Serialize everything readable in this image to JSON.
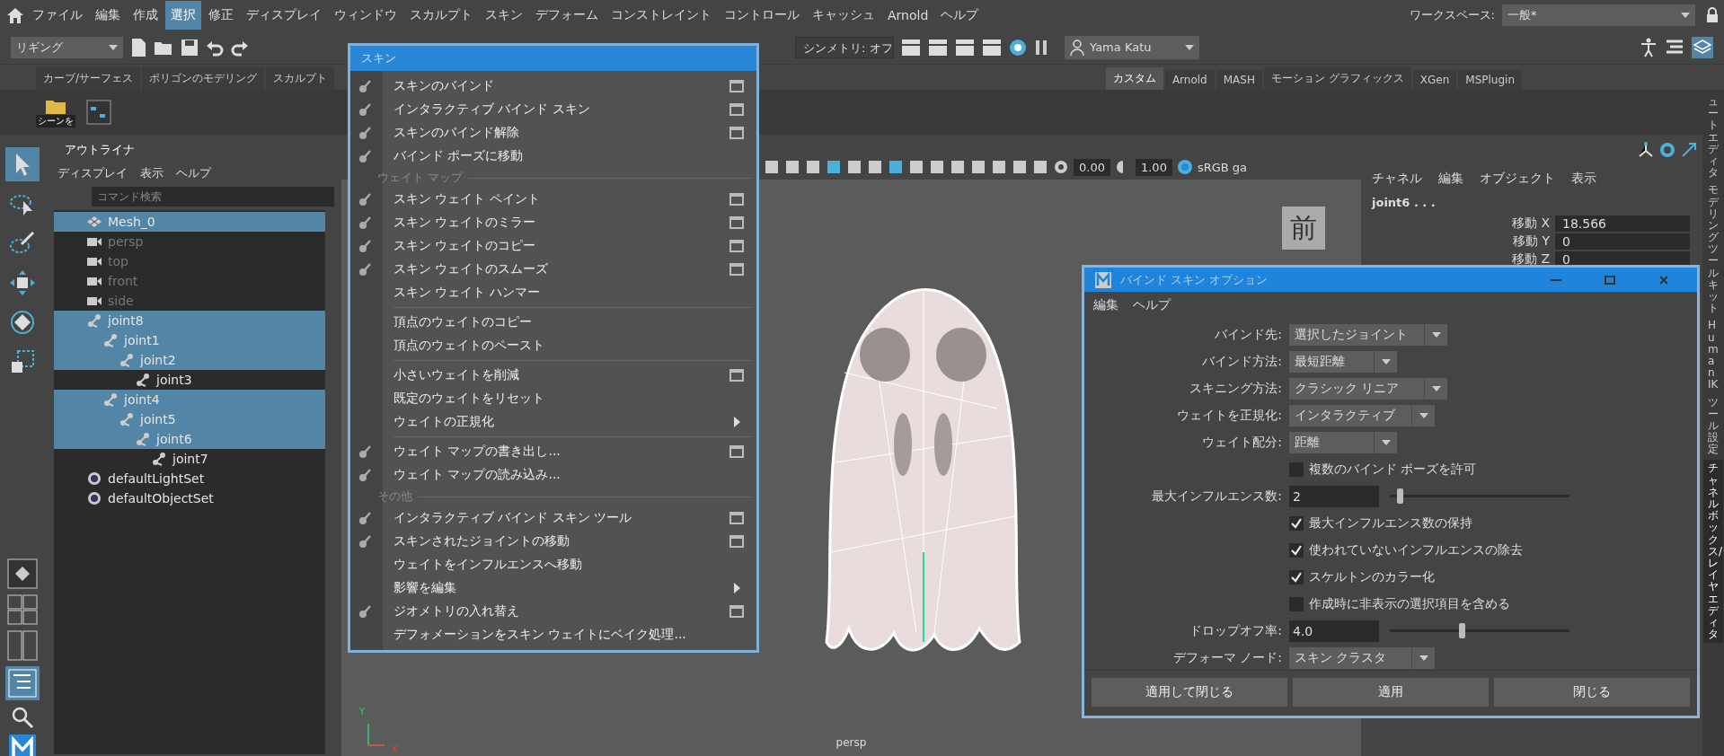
{
  "menu_bar": {
    "items": [
      {
        "label": "ファイル",
        "selected": false
      },
      {
        "label": "編集",
        "selected": false
      },
      {
        "label": "作成",
        "selected": false
      },
      {
        "label": "選択",
        "selected": true
      },
      {
        "label": "修正",
        "selected": false
      },
      {
        "label": "ディスプレイ",
        "selected": false
      },
      {
        "label": "ウィンドウ",
        "selected": false
      },
      {
        "label": "スカルプト",
        "selected": false
      },
      {
        "label": "スキン",
        "selected": false
      },
      {
        "label": "デフォーム",
        "selected": false
      },
      {
        "label": "コンストレイント",
        "selected": false
      },
      {
        "label": "コントロール",
        "selected": false
      },
      {
        "label": "キャッシュ",
        "selected": false
      },
      {
        "label": "Arnold",
        "selected": false
      },
      {
        "label": "ヘルプ",
        "selected": false
      }
    ],
    "workspace_label": "ワークスペース:",
    "workspace_value": "一般*"
  },
  "status_line": {
    "mode": "リギング",
    "symmetry": "シンメトリ: オフ",
    "user": "Yama Katu"
  },
  "shelf": {
    "tabs": [
      {
        "label": "カーブ/サーフェス",
        "selected": false
      },
      {
        "label": "ポリゴンのモデリング",
        "selected": false
      },
      {
        "label": "スカルプト",
        "selected": false
      },
      {
        "label": "カスタム",
        "selected": true
      },
      {
        "label": "Arnold",
        "selected": false
      },
      {
        "label": "MASH",
        "selected": false
      },
      {
        "label": "モーション グラフィックス",
        "selected": false
      },
      {
        "label": "XGen",
        "selected": false
      },
      {
        "label": "MSPlugin",
        "selected": false
      }
    ],
    "items": [
      {
        "label": "シーンを"
      }
    ]
  },
  "toolbox": {
    "tools": [
      {
        "kind": "select",
        "selected": true
      },
      {
        "kind": "lasso",
        "selected": false
      },
      {
        "kind": "paint",
        "selected": false
      },
      {
        "kind": "move",
        "selected": false
      },
      {
        "kind": "rotate",
        "selected": false
      },
      {
        "kind": "scale",
        "selected": false
      }
    ]
  },
  "outliner": {
    "tab": "アウトライナ",
    "menus": [
      "ディスプレイ",
      "表示",
      "ヘルプ"
    ],
    "placeholder": "コマンド検索",
    "items": [
      {
        "label": "Mesh_0",
        "kind": "mesh",
        "selected": true,
        "dimmed": false
      },
      {
        "label": "persp",
        "kind": "camera",
        "selected": false,
        "dimmed": true
      },
      {
        "label": "top",
        "kind": "camera",
        "selected": false,
        "dimmed": true
      },
      {
        "label": "front",
        "kind": "camera",
        "selected": false,
        "dimmed": true
      },
      {
        "label": "side",
        "kind": "camera",
        "selected": false,
        "dimmed": true
      },
      {
        "label": "joint8",
        "kind": "joint",
        "selected": true,
        "dimmed": false,
        "children": [
          {
            "label": "joint1",
            "kind": "joint",
            "selected": true,
            "dimmed": false,
            "children": [
              {
                "label": "joint2",
                "kind": "joint",
                "selected": true,
                "dimmed": false,
                "children": [
                  {
                    "label": "joint3",
                    "kind": "joint",
                    "selected": false,
                    "dimmed": false
                  }
                ]
              }
            ]
          },
          {
            "label": "joint4",
            "kind": "joint",
            "selected": true,
            "dimmed": false,
            "children": [
              {
                "label": "joint5",
                "kind": "joint",
                "selected": true,
                "dimmed": false,
                "children": [
                  {
                    "label": "joint6",
                    "kind": "joint",
                    "selected": true,
                    "dimmed": false,
                    "children": [
                      {
                        "label": "joint7",
                        "kind": "joint",
                        "selected": false,
                        "dimmed": false
                      }
                    ]
                  }
                ]
              }
            ]
          }
        ]
      },
      {
        "label": "defaultLightSet",
        "kind": "set",
        "selected": false,
        "dimmed": false
      },
      {
        "label": "defaultObjectSet",
        "kind": "set",
        "selected": false,
        "dimmed": false
      }
    ]
  },
  "skin_menu": {
    "title": "スキン",
    "items": [
      {
        "kind": "item",
        "label": "スキンのバインド",
        "icon": true,
        "option_box": true,
        "submenu": false
      },
      {
        "kind": "item",
        "label": "インタラクティブ バインド スキン",
        "icon": true,
        "option_box": true,
        "submenu": false
      },
      {
        "kind": "item",
        "label": "スキンのバインド解除",
        "icon": true,
        "option_box": true,
        "submenu": false
      },
      {
        "kind": "item",
        "label": "バインド ポーズに移動",
        "icon": true,
        "option_box": false,
        "submenu": false
      },
      {
        "kind": "section",
        "label": "ウェイト マップ"
      },
      {
        "kind": "item",
        "label": "スキン ウェイト ペイント",
        "icon": true,
        "option_box": true,
        "submenu": false
      },
      {
        "kind": "item",
        "label": "スキン ウェイトのミラー",
        "icon": true,
        "option_box": true,
        "submenu": false
      },
      {
        "kind": "item",
        "label": "スキン ウェイトのコピー",
        "icon": true,
        "option_box": true,
        "submenu": false
      },
      {
        "kind": "item",
        "label": "スキン ウェイトのスムーズ",
        "icon": true,
        "option_box": true,
        "submenu": false
      },
      {
        "kind": "item",
        "label": "スキン ウェイト ハンマー",
        "icon": false,
        "option_box": false,
        "submenu": false
      },
      {
        "kind": "separator"
      },
      {
        "kind": "item",
        "label": "頂点のウェイトのコピー",
        "icon": false,
        "option_box": false,
        "submenu": false
      },
      {
        "kind": "item",
        "label": "頂点のウェイトのペースト",
        "icon": false,
        "option_box": false,
        "submenu": false
      },
      {
        "kind": "separator"
      },
      {
        "kind": "item",
        "label": "小さいウェイトを削減",
        "icon": false,
        "option_box": true,
        "submenu": false
      },
      {
        "kind": "item",
        "label": "既定のウェイトをリセット",
        "icon": false,
        "option_box": false,
        "submenu": false
      },
      {
        "kind": "item",
        "label": "ウェイトの正規化",
        "icon": false,
        "option_box": false,
        "submenu": true
      },
      {
        "kind": "separator"
      },
      {
        "kind": "item",
        "label": "ウェイト マップの書き出し...",
        "icon": true,
        "option_box": true,
        "submenu": false
      },
      {
        "kind": "item",
        "label": "ウェイト マップの読み込み...",
        "icon": true,
        "option_box": false,
        "submenu": false
      },
      {
        "kind": "section",
        "label": "その他"
      },
      {
        "kind": "item",
        "label": "インタラクティブ バインド スキン ツール",
        "icon": true,
        "option_box": true,
        "submenu": false
      },
      {
        "kind": "item",
        "label": "スキンされたジョイントの移動",
        "icon": true,
        "option_box": true,
        "submenu": false
      },
      {
        "kind": "item",
        "label": "ウェイトをインフルエンスへ移動",
        "icon": false,
        "option_box": false,
        "submenu": false
      },
      {
        "kind": "item",
        "label": "影響を編集",
        "icon": false,
        "option_box": false,
        "submenu": true
      },
      {
        "kind": "item",
        "label": "ジオメトリの入れ替え",
        "icon": true,
        "option_box": true,
        "submenu": false
      },
      {
        "kind": "item",
        "label": "デフォメーションをスキン ウェイトにベイク処理...",
        "icon": false,
        "option_box": false,
        "submenu": false
      }
    ]
  },
  "viewport": {
    "exposure": "0.00",
    "gamma": "1.00",
    "color_space": "sRGB ga",
    "view_cube": "前",
    "camera": "persp",
    "axis_y": "Y",
    "axis_x": "X"
  },
  "channel_box": {
    "menus": [
      "チャネル",
      "編集",
      "オブジェクト",
      "表示"
    ],
    "node": "joint6 . . .",
    "attributes": [
      {
        "label": "移動 X",
        "value": "18.566"
      },
      {
        "label": "移動 Y",
        "value": "0"
      },
      {
        "label": "移動 Z",
        "value": "0"
      }
    ]
  },
  "side_tabs": [
    {
      "label": "ュートエディタ",
      "selected": false
    },
    {
      "label": "モデリングツールキット",
      "selected": false
    },
    {
      "label": "Human IK",
      "selected": false
    },
    {
      "label": "ツール設定",
      "selected": false
    },
    {
      "label": "チャネルボックス/レイヤエディタ",
      "selected": true
    }
  ],
  "bind_dialog": {
    "title": "バインド スキン オプション",
    "menus": [
      "編集",
      "ヘルプ"
    ],
    "rows": [
      {
        "kind": "dropdown",
        "label": "バインド先:",
        "value": "選択したジョイント"
      },
      {
        "kind": "dropdown",
        "label": "バインド方法:",
        "value": "最短距離"
      },
      {
        "kind": "dropdown",
        "label": "スキニング方法:",
        "value": "クラシック リニア"
      },
      {
        "kind": "dropdown",
        "label": "ウェイトを正規化:",
        "value": "インタラクティブ"
      },
      {
        "kind": "dropdown",
        "label": "ウェイト配分:",
        "value": "距離"
      },
      {
        "kind": "checkbox",
        "label": "複数のバインド ポーズを許可",
        "checked": false
      },
      {
        "kind": "slider",
        "label": "最大インフルエンス数:",
        "value": "2",
        "level": 0.04
      },
      {
        "kind": "checkbox",
        "label": "最大インフルエンス数の保持",
        "checked": true
      },
      {
        "kind": "checkbox",
        "label": "使われていないインフルエンスの除去",
        "checked": true
      },
      {
        "kind": "checkbox",
        "label": "スケルトンのカラー化",
        "checked": true
      },
      {
        "kind": "checkbox",
        "label": "作成時に非表示の選択項目を含める",
        "checked": false
      },
      {
        "kind": "slider",
        "label": "ドロップオフ率:",
        "value": "4.0",
        "level": 0.4
      },
      {
        "kind": "dropdown",
        "label": "デフォーマ ノード:",
        "value": "スキン クラスタ"
      }
    ],
    "buttons": [
      "適用して閉じる",
      "適用",
      "閉じる"
    ]
  }
}
